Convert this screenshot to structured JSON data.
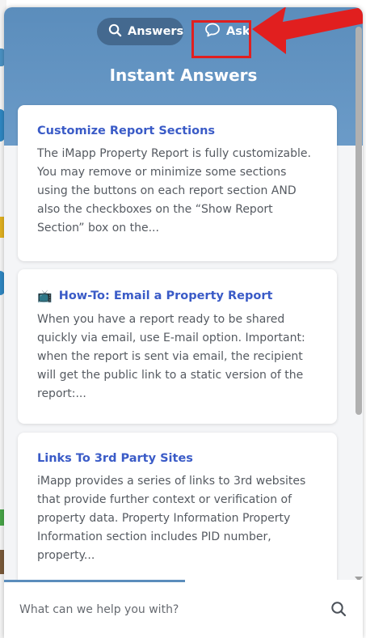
{
  "tabs": {
    "answers_label": "Answers",
    "ask_label": "Ask"
  },
  "header": {
    "title": "Instant Answers"
  },
  "articles": [
    {
      "icon": "",
      "title": "Customize Report Sections",
      "excerpt": "The iMapp Property Report is fully customizable. You may remove or minimize some sections using the buttons on each report section AND also the checkboxes on the “Show Report Section” box on the..."
    },
    {
      "icon": "📺",
      "title": "How-To: Email a Property Report",
      "excerpt": "When you have a report ready to be shared quickly via email, use E-mail option. Important: when the report is sent via email, the recipient will get the public link to a static version of the report:..."
    },
    {
      "icon": "",
      "title": "Links To 3rd Party Sites",
      "excerpt": "iMapp provides a series of links to 3rd websites that provide further context or verification of property data. Property Information Property Information section includes PID number, property..."
    }
  ],
  "search": {
    "placeholder": "What can we help you with?",
    "value": ""
  },
  "colors": {
    "header": "#5b8dbc",
    "active_tab": "#44698f",
    "link": "#3a5bc7",
    "annotation": "#e11f1f"
  },
  "icons": {
    "answers_tab": "search-icon",
    "ask_tab": "chat-bubble-icon",
    "search": "search-icon",
    "article_2": "television-icon"
  }
}
